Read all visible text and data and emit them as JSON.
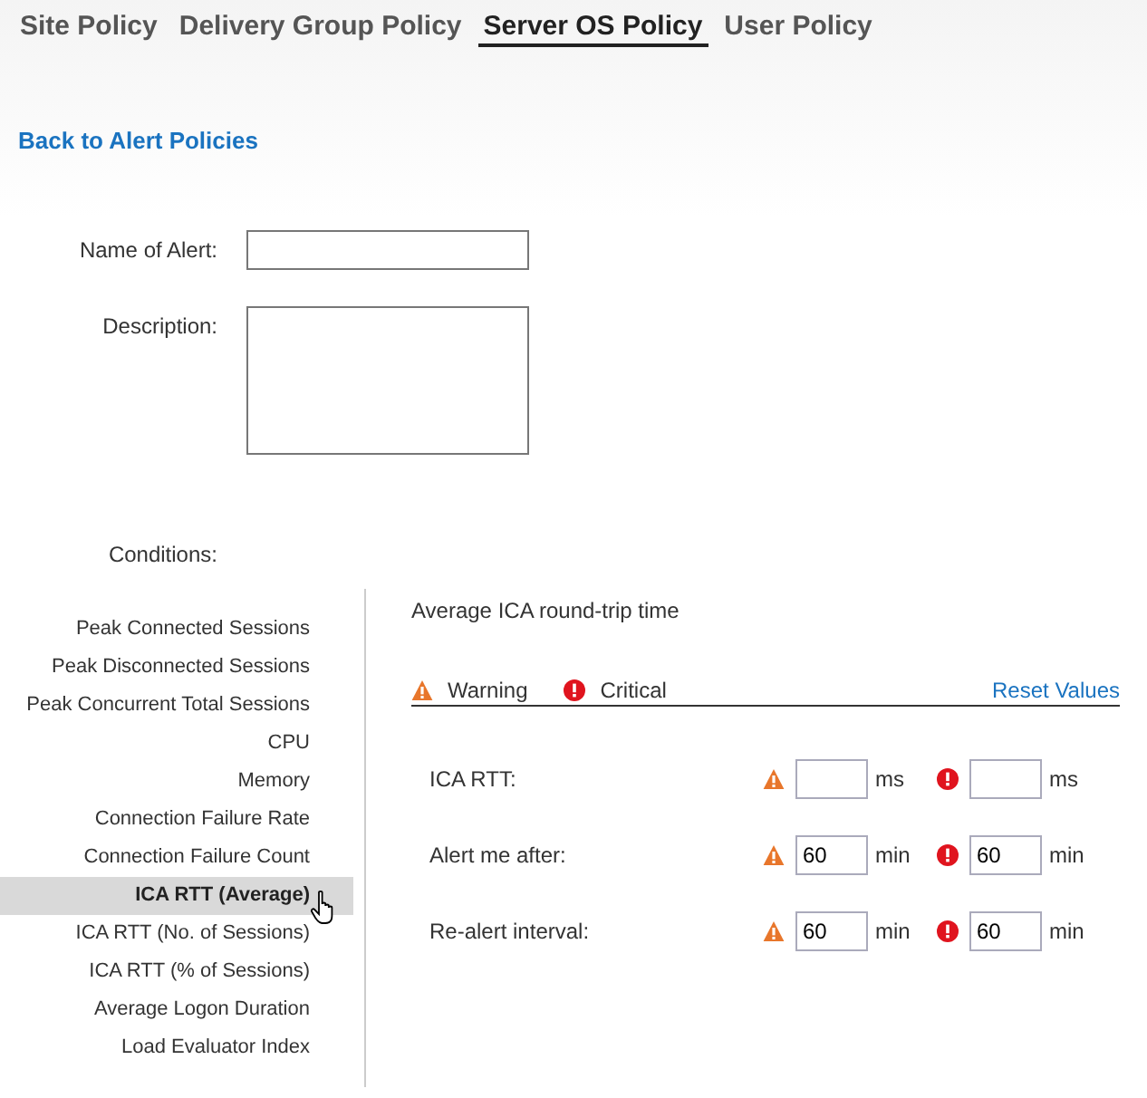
{
  "tabs": [
    {
      "label": "Site Policy",
      "selected": false
    },
    {
      "label": "Delivery Group Policy",
      "selected": false
    },
    {
      "label": "Server OS Policy",
      "selected": true
    },
    {
      "label": "User Policy",
      "selected": false
    }
  ],
  "back_link": "Back to Alert Policies",
  "form": {
    "name_label": "Name of Alert:",
    "description_label": "Description:",
    "conditions_label": "Conditions:"
  },
  "conditions": [
    {
      "label": "Peak Connected Sessions",
      "selected": false
    },
    {
      "label": "Peak Disconnected Sessions",
      "selected": false
    },
    {
      "label": "Peak Concurrent Total Sessions",
      "selected": false
    },
    {
      "label": "CPU",
      "selected": false
    },
    {
      "label": "Memory",
      "selected": false
    },
    {
      "label": "Connection Failure Rate",
      "selected": false
    },
    {
      "label": "Connection Failure Count",
      "selected": false
    },
    {
      "label": "ICA RTT (Average)",
      "selected": true
    },
    {
      "label": "ICA RTT (No. of Sessions)",
      "selected": false
    },
    {
      "label": "ICA RTT (% of Sessions)",
      "selected": false
    },
    {
      "label": "Average Logon Duration",
      "selected": false
    },
    {
      "label": "Load Evaluator Index",
      "selected": false
    }
  ],
  "detail": {
    "title": "Average ICA round-trip time",
    "legend": [
      {
        "kind": "warning",
        "label": "Warning"
      },
      {
        "kind": "critical",
        "label": "Critical"
      }
    ],
    "reset_link": "Reset Values",
    "rows": [
      {
        "label": "ICA RTT:",
        "warning_unit": "ms",
        "critical_unit": "ms"
      },
      {
        "label": "Alert me after:",
        "warning_value": "60",
        "warning_unit": "min",
        "critical_value": "60",
        "critical_unit": "min"
      },
      {
        "label": "Re-alert interval:",
        "warning_value": "60",
        "warning_unit": "min",
        "critical_value": "60",
        "critical_unit": "min"
      }
    ]
  }
}
